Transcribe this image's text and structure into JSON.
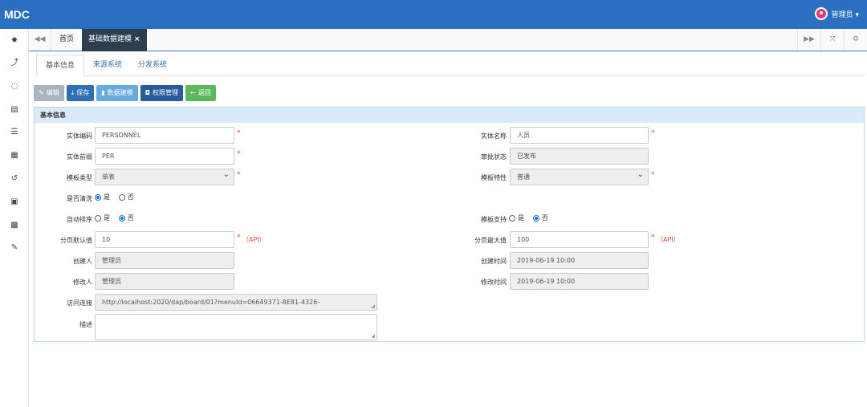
{
  "app": {
    "logo": "MDC",
    "user": "管理员 ▾"
  },
  "tabs": {
    "home": "首页",
    "active": "基础数据建模"
  },
  "subtabs": [
    "基本信息",
    "来源系统",
    "分发系统"
  ],
  "toolbar": {
    "edit": "编辑",
    "save": "保存",
    "model": "数据建模",
    "perm": "权限管理",
    "back": "返回"
  },
  "panel": {
    "title": "基本信息"
  },
  "form": {
    "code": {
      "label": "实体编码",
      "value": "PERSONNEL"
    },
    "name": {
      "label": "实体名称",
      "value": "人员"
    },
    "prefix": {
      "label": "实体前缀",
      "value": "PER"
    },
    "approval": {
      "label": "审批状态",
      "value": "已发布"
    },
    "template_type": {
      "label": "模板类型",
      "value": "单表"
    },
    "template_feature": {
      "label": "模板特性",
      "value": "普通"
    },
    "clean": {
      "label": "是否清洗",
      "yes": "是",
      "no": "否",
      "selected": "yes"
    },
    "autosort": {
      "label": "自动排序",
      "yes": "是",
      "no": "否",
      "selected": "no"
    },
    "template_support": {
      "label": "模板支持",
      "yes": "是",
      "no": "否",
      "selected": "no"
    },
    "page_default": {
      "label": "分页默认值",
      "value": "10",
      "note": "（API）"
    },
    "page_max": {
      "label": "分页最大值",
      "value": "100",
      "note": "（API）"
    },
    "creator": {
      "label": "创建人",
      "value": "管理员"
    },
    "created_time": {
      "label": "创建时间",
      "value": "2019-06-19 10:00"
    },
    "modifier": {
      "label": "修改人",
      "value": "管理员"
    },
    "modified_time": {
      "label": "修改时间",
      "value": "2019-06-19 10:00"
    },
    "link": {
      "label": "访问连接",
      "value": "http://localhost:2020/dap/board/01?menuId=06649371-8E81-4326-"
    },
    "desc": {
      "label": "描述",
      "value": ""
    }
  }
}
